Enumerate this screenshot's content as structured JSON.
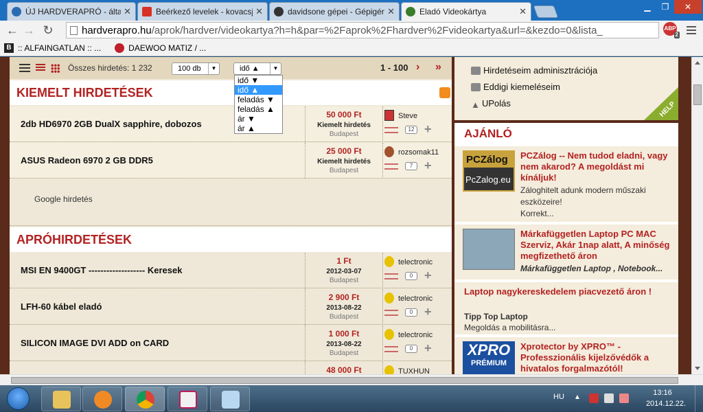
{
  "browser": {
    "tabs": [
      {
        "title": "ÚJ HARDVERAPRÓ - általá",
        "color": "#2b6cb0"
      },
      {
        "title": "Beérkező levelek - kovacsj",
        "color": "#d93025"
      },
      {
        "title": "davidsone gépei - Gépigén",
        "color": "#333333"
      },
      {
        "title": "Eladó Videokártya",
        "color": "#3a7d2c"
      }
    ],
    "url_host": "hardverapro.hu",
    "url_path": "/aprok/hardver/videokartya?h=h&par=%2Faprok%2Fhardver%2Fvideokartya&url=&kezdo=0&lista_",
    "abp_label": "ABP",
    "abp_count": "2",
    "bookmarks": [
      {
        "label": ":: ALFAINGATLAN :: ...",
        "icon": "B"
      },
      {
        "label": "DAEWOO MATIZ / ...",
        "icon": "D"
      }
    ]
  },
  "listbar": {
    "total": "Összes hirdetés: 1 232",
    "perpage": "100 db",
    "sort": "idő ▲",
    "range": "1 - 100"
  },
  "sort_options": [
    "idő ▼",
    "idő ▲",
    "feladás ▼",
    "feladás ▲",
    "ár ▼",
    "ár ▲"
  ],
  "featured": {
    "heading": "KIEMELT HIRDETÉSEK",
    "items": [
      {
        "title": "2db HD6970 2GB DualX sapphire, dobozos",
        "price": "50 000 Ft",
        "date": "Kiemelt hirdetés",
        "city": "Budapest",
        "user": "Steve",
        "comments": "12"
      },
      {
        "title": "ASUS Radeon 6970 2 GB DDR5",
        "price": "25 000 Ft",
        "date": "Kiemelt hirdetés",
        "city": "Budapest",
        "user": "rozsomak11",
        "comments": "7"
      }
    ]
  },
  "google_ad": "Google hirdetés",
  "classifieds": {
    "heading": "APRÓHIRDETÉSEK",
    "items": [
      {
        "title": "MSI EN 9400GT ------------------- Keresek",
        "price": "1 Ft",
        "date": "2012-03-07",
        "city": "Budapest",
        "user": "telectronic",
        "comments": "0"
      },
      {
        "title": "LFH-60 kábel eladó",
        "price": "2 900 Ft",
        "date": "2013-08-22",
        "city": "Budapest",
        "user": "telectronic",
        "comments": "0"
      },
      {
        "title": "SILICON IMAGE DVI ADD on CARD",
        "price": "1 000 Ft",
        "date": "2013-08-22",
        "city": "Budapest",
        "user": "telectronic",
        "comments": "0"
      },
      {
        "title": "",
        "price": "48 000 Ft",
        "date": "",
        "city": "",
        "user": "TUXHUN",
        "comments": ""
      }
    ]
  },
  "usermenu": {
    "items": [
      "Hirdetéseim adminisztrációja",
      "Eddigi kiemeléseim",
      "UPolás"
    ],
    "help": "HELP"
  },
  "ajanlo": {
    "heading": "AJÁNLÓ",
    "items": [
      {
        "title": "PCZálog -- Nem tudod eladni, vagy nem akarod? A megoldást mi kínáljuk!",
        "desc": "Záloghitelt adunk modern műszaki eszközeire!",
        "link": "Korrekt...",
        "img_top": "PCZálog",
        "img_bottom": "PcZalog.eu"
      },
      {
        "title": "Márkafüggetlen Laptop PC MAC Szerviz, Akár 1nap alatt, A minőség megfizethető áron",
        "desc": "Márkafüggetlen Laptop , Notebook...",
        "link": ""
      },
      {
        "title": "Laptop nagykereskedelem piacvezető áron !",
        "desc": "Tipp Top Laptop",
        "link": "Megoldás a mobilitásra..."
      },
      {
        "title": "Xprotector by XPRO™ - Professzionális kijelzővédők a hivatalos forgalmazótól!",
        "desc": "",
        "link": "",
        "img_top": "XPRO",
        "img_bottom": "PRÉMIUM"
      }
    ]
  },
  "taskbar": {
    "lang": "HU",
    "time": "13:16",
    "date": "2014.12.22."
  }
}
